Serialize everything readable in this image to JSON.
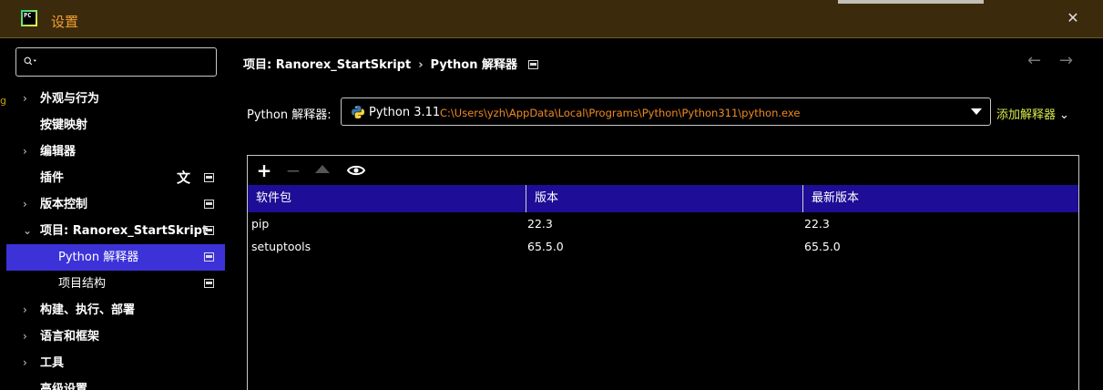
{
  "window": {
    "title": "设置",
    "app_icon_text": "PC"
  },
  "search": {
    "value": "",
    "placeholder": ""
  },
  "left_edge_text": "g",
  "sidebar": {
    "items": [
      {
        "label": "外观与行为",
        "expandable": true
      },
      {
        "label": "按键映射",
        "expandable": false
      },
      {
        "label": "编辑器",
        "expandable": true
      },
      {
        "label": "插件",
        "expandable": false
      },
      {
        "label": "版本控制",
        "expandable": true
      },
      {
        "label": "项目: Ranorex_StartSkript",
        "expandable": true,
        "expanded": true
      },
      {
        "label": "Python 解释器",
        "expandable": false,
        "selected": true
      },
      {
        "label": "项目结构",
        "expandable": false
      },
      {
        "label": "构建、执行、部署",
        "expandable": true
      },
      {
        "label": "语言和框架",
        "expandable": true
      },
      {
        "label": "工具",
        "expandable": true
      },
      {
        "label": "高级设置",
        "expandable": false
      }
    ]
  },
  "breadcrumb": {
    "project": "项目: Ranorex_StartSkript",
    "separator": "›",
    "page": "Python 解释器"
  },
  "interpreter": {
    "label": "Python 解释器:",
    "name": "Python 3.11",
    "path": "C:\\Users\\yzh\\AppData\\Local\\Programs\\Python\\Python311\\python.exe",
    "add_label": "添加解释器"
  },
  "packages": {
    "columns": [
      "软件包",
      "版本",
      "最新版本"
    ],
    "rows": [
      {
        "name": "pip",
        "version": "22.3",
        "latest": "22.3"
      },
      {
        "name": "setuptools",
        "version": "65.5.0",
        "latest": "65.5.0"
      }
    ]
  },
  "colors": {
    "titlebar_bg": "#3b2a0c",
    "selection": "#3c32d8",
    "table_header": "#1e0d96",
    "path_text": "#f08a20",
    "link_text": "#d6e84a",
    "title_text": "#f0a030"
  },
  "icons": {
    "close": "close-icon",
    "search": "search-icon",
    "back": "arrow-left-icon",
    "forward": "arrow-right-icon",
    "add": "plus-icon",
    "remove": "minus-icon",
    "upgrade": "triangle-up-icon",
    "show": "eye-icon"
  }
}
